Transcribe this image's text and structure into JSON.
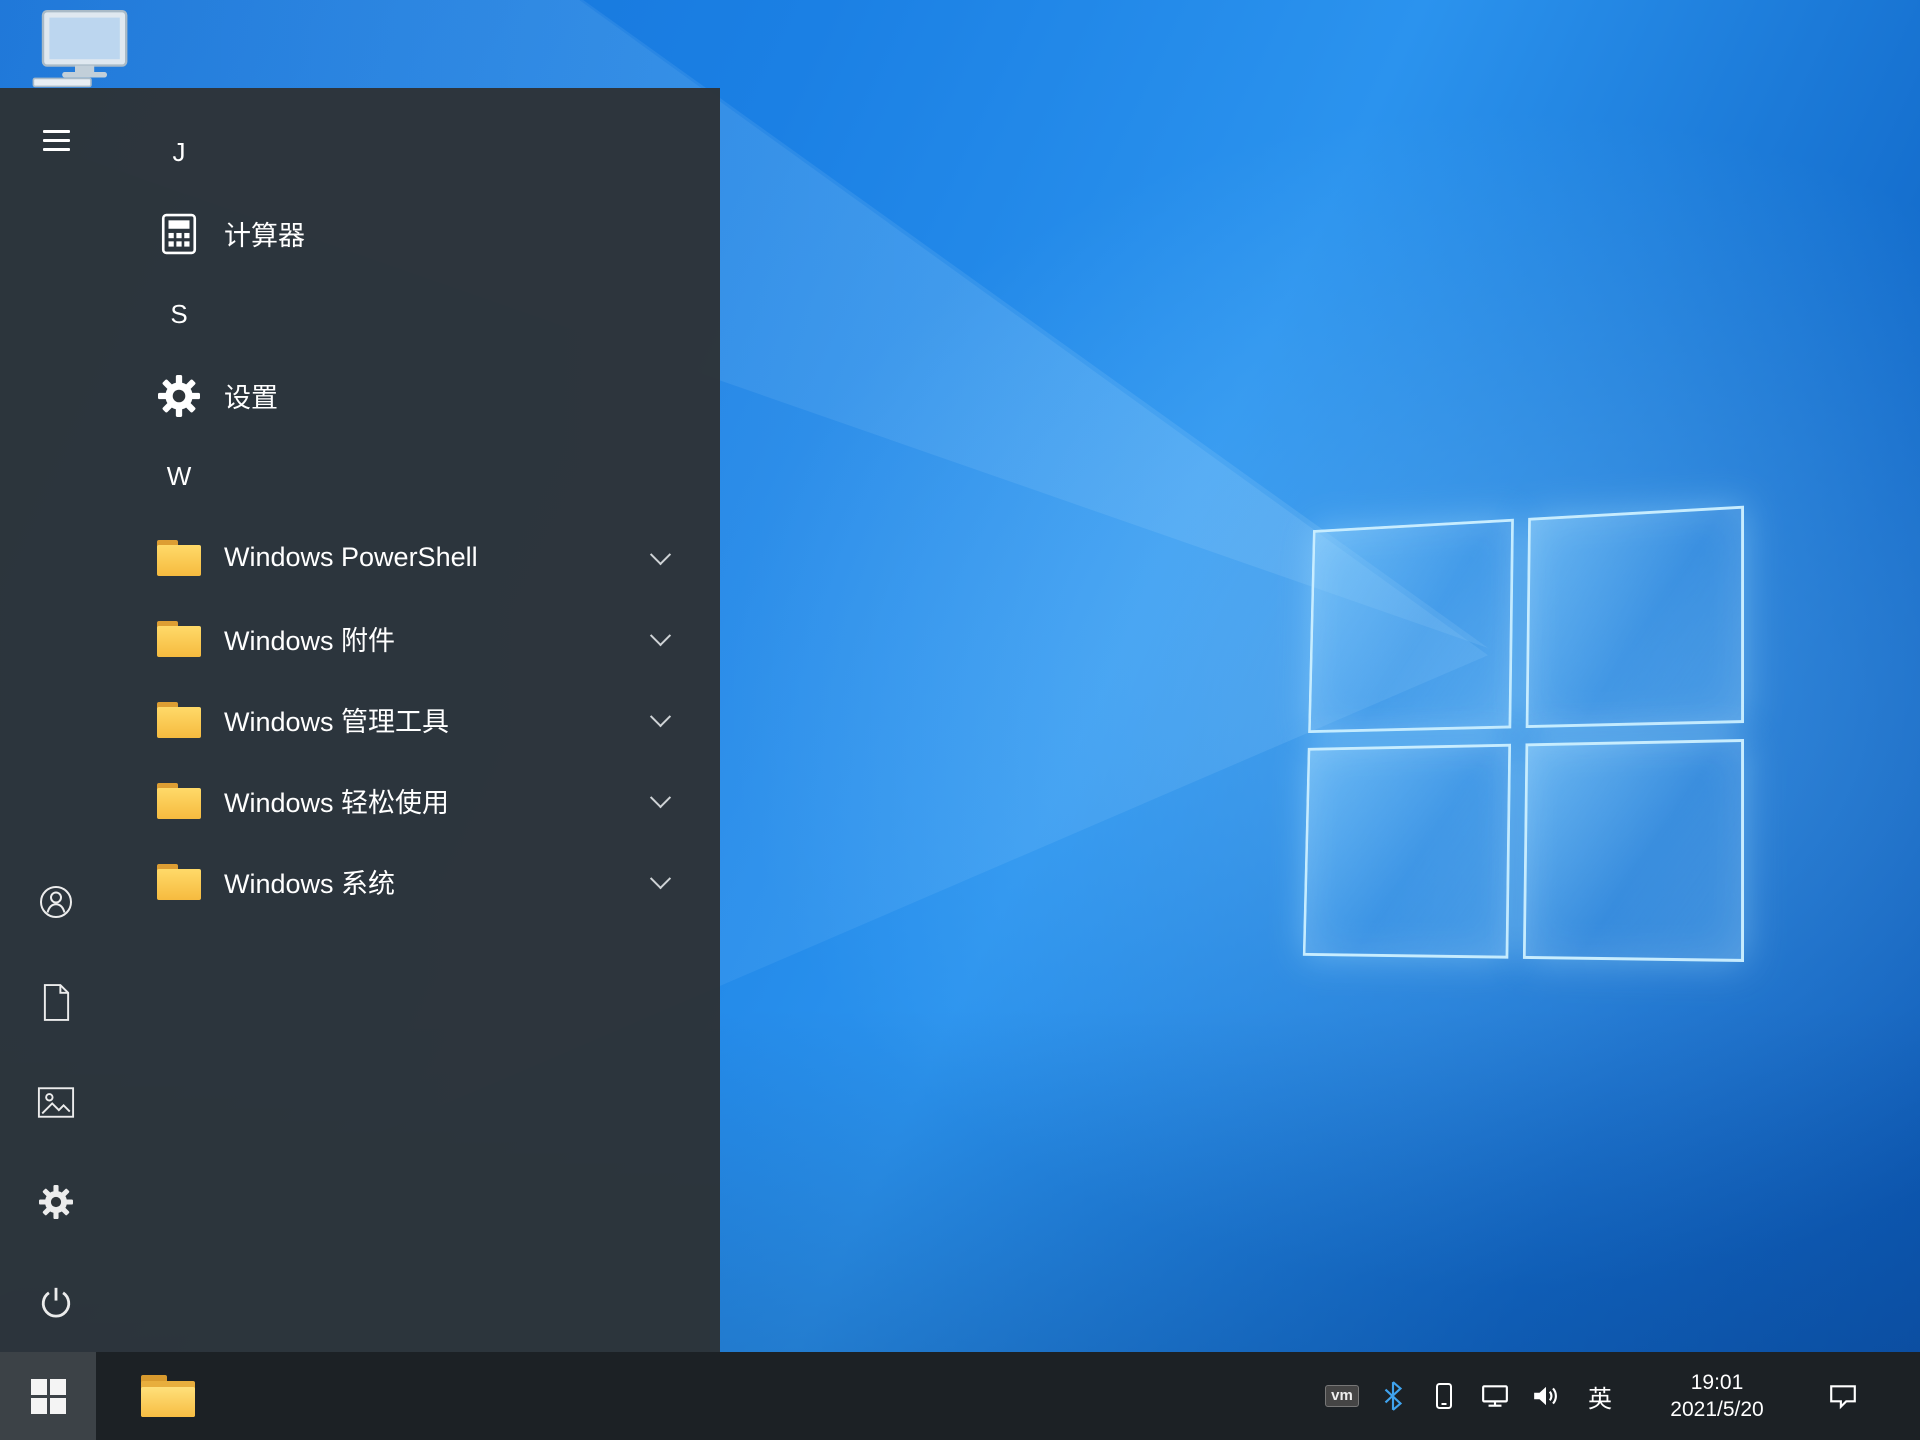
{
  "desktop": {
    "icons": [
      {
        "name": "this-pc"
      }
    ]
  },
  "start_menu": {
    "rail": {
      "items": [
        "expand-menu",
        "user-account",
        "documents",
        "pictures",
        "settings",
        "power"
      ]
    },
    "rows": [
      {
        "kind": "letter",
        "text": "J"
      },
      {
        "kind": "app",
        "text": "计算器",
        "icon": "calculator-icon"
      },
      {
        "kind": "letter",
        "text": "S"
      },
      {
        "kind": "app",
        "text": "设置",
        "icon": "gear-icon"
      },
      {
        "kind": "letter",
        "text": "W"
      },
      {
        "kind": "folder",
        "text": "Windows PowerShell",
        "icon": "folder-icon",
        "expandable": true
      },
      {
        "kind": "folder",
        "text": "Windows 附件",
        "icon": "folder-icon",
        "expandable": true
      },
      {
        "kind": "folder",
        "text": "Windows 管理工具",
        "icon": "folder-icon",
        "expandable": true
      },
      {
        "kind": "folder",
        "text": "Windows 轻松使用",
        "icon": "folder-icon",
        "expandable": true
      },
      {
        "kind": "folder",
        "text": "Windows 系统",
        "icon": "folder-icon",
        "expandable": true
      }
    ]
  },
  "taskbar": {
    "pinned": [
      {
        "name": "file-explorer"
      }
    ],
    "tray": {
      "vmware": "vm",
      "ime": "英",
      "time": "19:01",
      "date": "2021/5/20"
    }
  },
  "colors": {
    "menu_bg": "#2d3338",
    "taskbar_bg": "#1c2125",
    "start_button_bg": "#3c4247",
    "wallpaper_blue": "#1b80e4",
    "logo_edge": "#cdeeff",
    "folder_yellow": "#f6bb3f",
    "bluetooth_blue": "#3fa3ee"
  }
}
